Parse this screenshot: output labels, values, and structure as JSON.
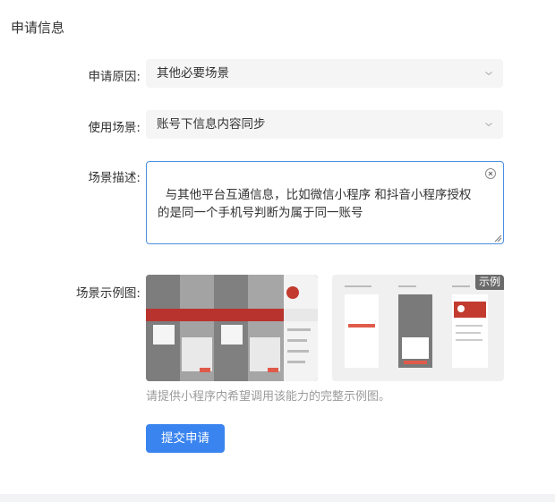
{
  "section": {
    "title": "申请信息"
  },
  "form": {
    "reason": {
      "label": "申请原因:",
      "value": "其他必要场景"
    },
    "scenario": {
      "label": "使用场景:",
      "value": "账号下信息内容同步"
    },
    "description": {
      "label": "场景描述:",
      "value": "与其他平台互通信息，比如微信小程序 和抖音小程序授权的是同一个手机号判断为属于同一账号"
    },
    "examples": {
      "label": "场景示例图:",
      "badge": "示例",
      "hint": "请提供小程序内希望调用该能力的完整示例图。"
    },
    "submit_label": "提交申请"
  },
  "colors": {
    "accent": "#3a84f0",
    "field_bg": "#f5f5f5",
    "focus_border": "#4a8fe0"
  }
}
